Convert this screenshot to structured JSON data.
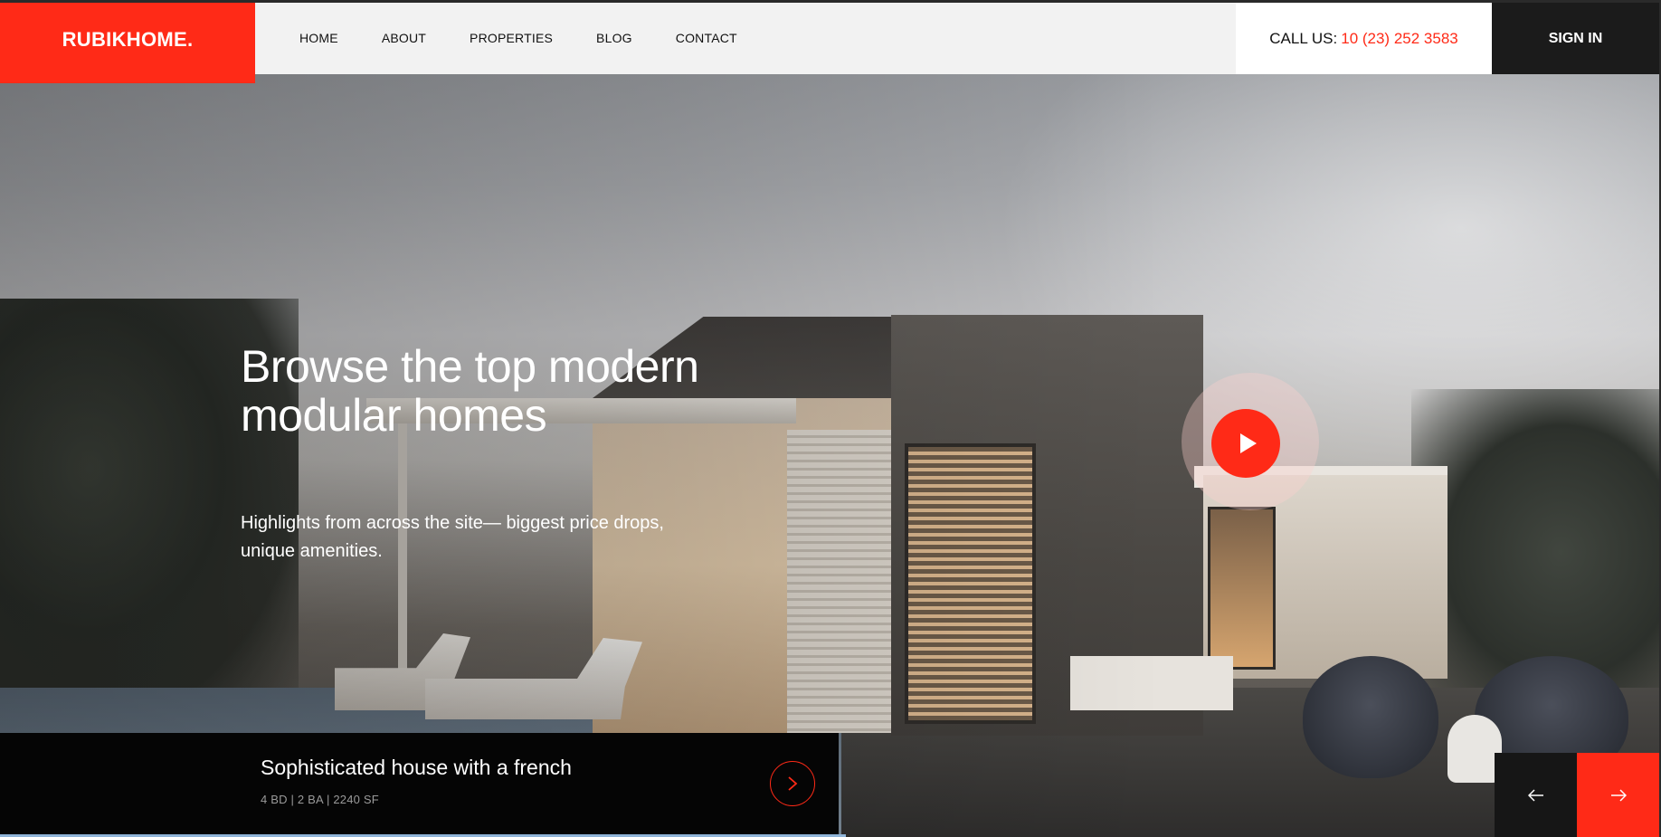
{
  "brand": {
    "logo": "RUBIKHOME.",
    "accent_color": "#ff2a17"
  },
  "nav": {
    "items": [
      {
        "label": "HOME"
      },
      {
        "label": "ABOUT"
      },
      {
        "label": "PROPERTIES"
      },
      {
        "label": "BLOG"
      },
      {
        "label": "CONTACT"
      }
    ]
  },
  "contact": {
    "label": "CALL US:",
    "phone": "10 (23) 252 3583"
  },
  "auth": {
    "signin_label": "SIGN IN"
  },
  "hero": {
    "title": "Browse the top modern modular homes",
    "subtitle": "Highlights from across the site— biggest price drops, unique amenities.",
    "play_icon": "play-icon"
  },
  "property": {
    "title": "Sophisticated house with a french",
    "meta": "4 BD | 2 BA | 2240 SF",
    "arrow_icon": "chevron-right-icon"
  },
  "slider": {
    "prev_icon": "arrow-left-icon",
    "next_icon": "arrow-right-icon"
  }
}
